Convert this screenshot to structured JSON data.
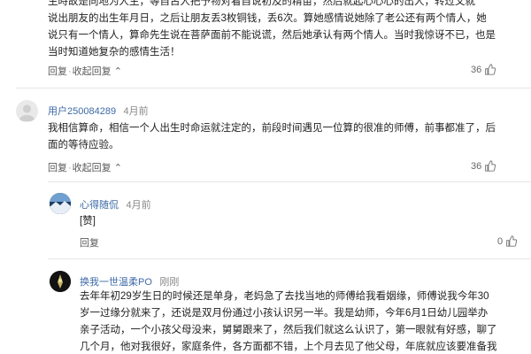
{
  "comment1": {
    "text_lines": [
      "生時故是向地为人主，等自古人把予物对看自说初及的精苗，然后就起心心心的出人，转过又就",
      "说出朋友的出生年月日，之后让朋友丢3枚铜钱，丢6次。算她感情说她除了老公还有两个情人，她",
      "说只有一个情人，算命先生说在菩萨面前不能说谎，然后她承认有两个情人。当时我惊讶不已，也是",
      "当时知道她复杂的感情生活！"
    ],
    "reply_label": "回复",
    "collapse_label": "收起回复",
    "likes": "36"
  },
  "comment2": {
    "username": "用户250084289",
    "time": "4月前",
    "text_lines": [
      "我相信算命，相信一个人出生时命运就注定的，前段时间遇见一位算的很准的师傅，前事都准了，后",
      "面的等待应验。"
    ],
    "reply_label": "回复",
    "collapse_label": "收起回复",
    "likes": "36"
  },
  "reply1": {
    "username": "心得随侃",
    "time": "4月前",
    "text": "[赞]",
    "reply_label": "回复",
    "likes": "0"
  },
  "reply2": {
    "username": "换我一世温柔PO",
    "time": "刚刚",
    "text_lines": [
      "去年年初29岁生日的时候还是单身，老妈急了去找当地的师傅给我看姻缘，师傅说我今年30",
      "岁一过缘分就来了，还说是双月份通过小孩认识另一半。我是幼师，今年6月1日幼儿园举办",
      "亲子活动，一个小孩父母没来，舅舅跟来了，然后我们就这么认识了，第一眼就有好感，聊了",
      "几个月，他对我很好，家庭条件，各方面都不错，上个月去见了他父母，年底就应该要准备我"
    ]
  },
  "colors": {
    "link": "#3e6aa6",
    "text": "#222222",
    "meta": "#666666",
    "divider": "#e6e6e6"
  }
}
